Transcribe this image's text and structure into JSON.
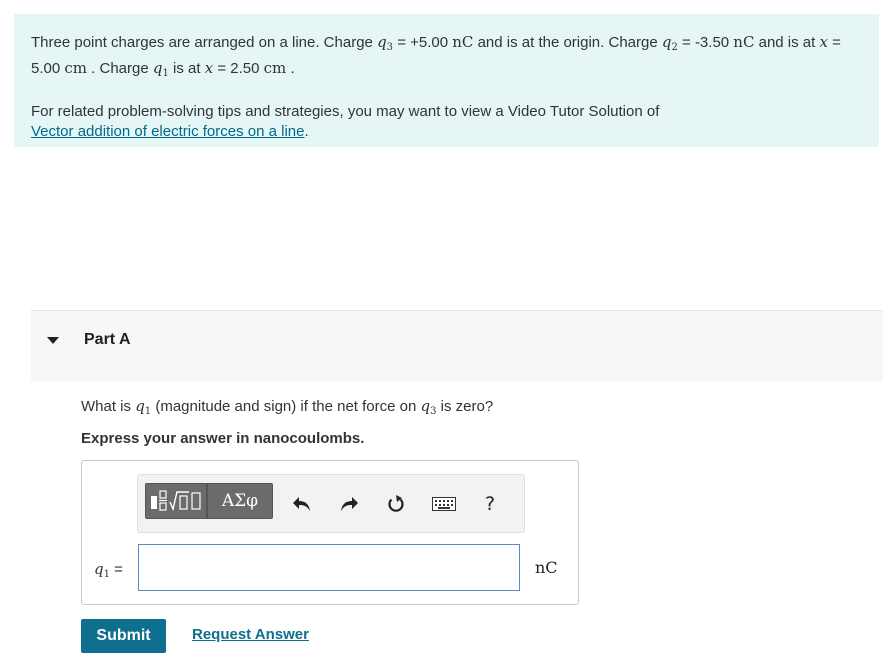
{
  "intro": {
    "text1": "Three point charges are arranged on a line. Charge ",
    "q3_var": "q",
    "q3_sub": "3",
    "text2": " = +5.00 ",
    "unit_nC": "nC",
    "text3": " and is at the origin. Charge ",
    "q2_var": "q",
    "q2_sub": "2",
    "text4": " = -3.50 ",
    "text5": " and is at ",
    "x_var": "x",
    "text6": " = 5.00 ",
    "unit_cm": "cm",
    "text7": " . Charge ",
    "q1_var": "q",
    "q1_sub": "1",
    "text8": " is at ",
    "text9": " = 2.50 ",
    "text10": " .",
    "tips_text": "For related problem-solving tips and strategies, you may want to view a Video Tutor Solution of",
    "tips_link": "Vector addition of electric forces on a line",
    "tips_end": "."
  },
  "part": {
    "title": "Part A",
    "question_pre": "What is ",
    "question_var": "q",
    "question_sub1": "1",
    "question_mid": " (magnitude and sign) if the net force on ",
    "question_sub3": "3",
    "question_post": " is zero?",
    "instruction": "Express your answer in nanocoulombs."
  },
  "toolbar": {
    "greek_label": "ΑΣφ",
    "help_label": "?"
  },
  "answer": {
    "label_var": "q",
    "label_sub": "1",
    "label_eq": " =",
    "value": "",
    "unit": "nC"
  },
  "actions": {
    "submit_label": "Submit",
    "request_label": "Request Answer"
  }
}
